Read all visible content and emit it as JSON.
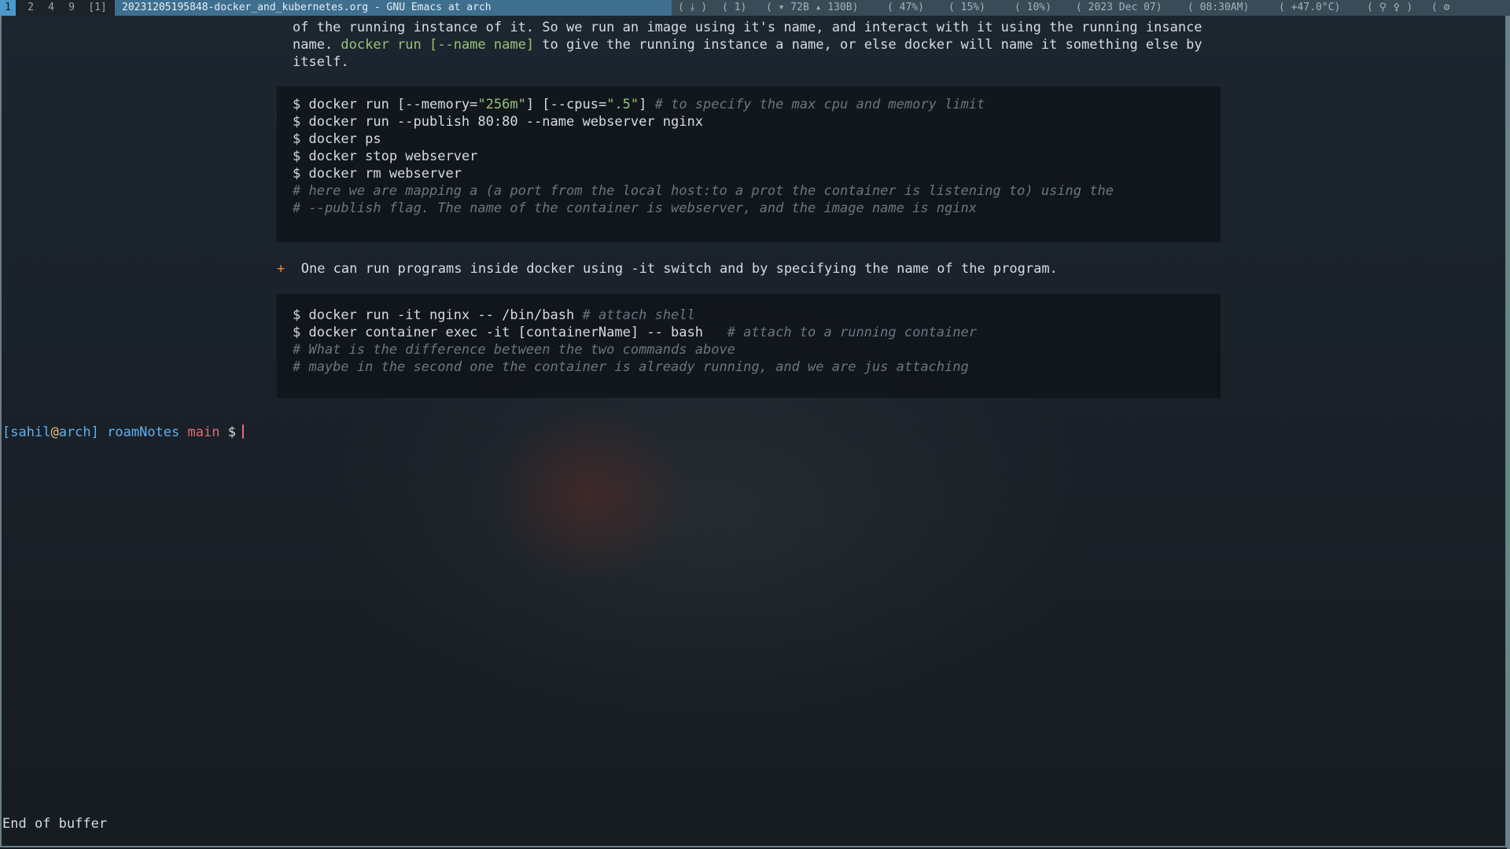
{
  "topbar": {
    "workspaces": [
      "1",
      "2",
      "4",
      "9",
      "[1]"
    ],
    "active_workspace": "1",
    "window_title": "20231205195848-docker_and_kubernetes.org - GNU Emacs at arch",
    "status": {
      "updates": "( ⤓ )",
      "mail": "( 1)",
      "network": "( ▾ 72B ▴ 130B)",
      "battery": "( 47%)",
      "volume": "( 15%)",
      "brightness": "( 10%)",
      "date": "( 2023 Dec 07)",
      "time": "( 08:30AM)",
      "temperature": "( +47.0°C)",
      "wifi": "( ⚲ ⚴ )",
      "settings": "( ⚙ "
    }
  },
  "editor": {
    "para_line1": "of the running instance of it. So we run an image using it's name, and interact with it using the running insance",
    "para_line2_pre": "name. ",
    "para_line2_code": "docker run [--name name]",
    "para_line2_post": " to give the running instance a name, or else docker will name it something else by",
    "para_line3": "itself.",
    "block1": {
      "l1_a": "$ docker run [--memory=",
      "l1_s1": "\"256m\"",
      "l1_b": "] [--cpus=",
      "l1_s2": "\".5\"",
      "l1_c": "] ",
      "l1_comment": "# to specify the max cpu and memory limit",
      "l2": "$ docker run --publish 80:80 --name webserver nginx",
      "l3": "$ docker ps",
      "l4": "$ docker stop webserver",
      "l5": "$ docker rm webserver",
      "l6": "# here we are mapping a (a port from the local host:to a prot the container is listening to) using the",
      "l7": "# --publish flag. The name of the container is webserver, and the image name is nginx"
    },
    "bullet_marker": "+",
    "bullet_text": "One can run programs inside docker using -it switch and by specifying the name of the program.",
    "block2": {
      "l1_cmd": "$ docker run -it nginx -- /bin/bash ",
      "l1_comment": "# attach shell",
      "l2_cmd": "$ docker container exec -it [containerName] -- bash   ",
      "l2_comment": "# attach to a running container",
      "l3": "# What is the difference between the two commands above",
      "l4": "# maybe in the second one the container is already running, and we are jus attaching"
    }
  },
  "prompt": {
    "open": "[",
    "user": "sahil",
    "at": "@",
    "host": "arch",
    "close": "]",
    "dir": "roamNotes",
    "branch": "main",
    "symbol": "$"
  },
  "echo_area": "End of buffer",
  "colors": {
    "accent": "#4a9acb",
    "string": "#98c379",
    "comment": "#6b7682",
    "bullet": "#e58a3a"
  }
}
